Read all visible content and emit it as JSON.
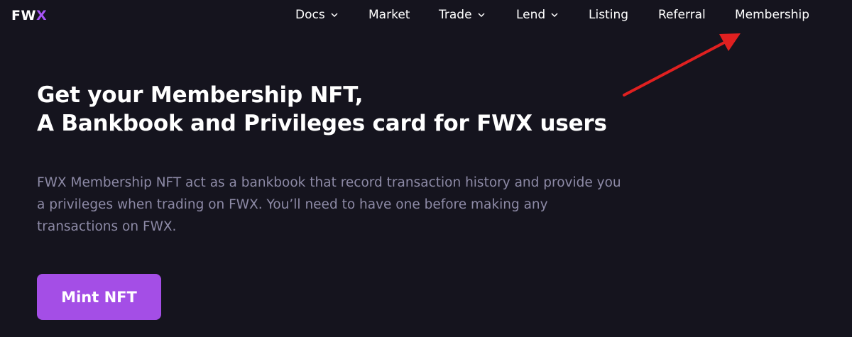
{
  "logo": {
    "part1": "FW",
    "part2": "X"
  },
  "nav": {
    "items": [
      {
        "label": "Docs",
        "dropdown": true
      },
      {
        "label": "Market",
        "dropdown": false
      },
      {
        "label": "Trade",
        "dropdown": true
      },
      {
        "label": "Lend",
        "dropdown": true
      },
      {
        "label": "Listing",
        "dropdown": false
      },
      {
        "label": "Referral",
        "dropdown": false
      },
      {
        "label": "Membership",
        "dropdown": false
      }
    ]
  },
  "hero": {
    "title_line1": "Get your Membership NFT,",
    "title_line2": "A Bankbook and Privileges card for FWX users",
    "description": "FWX Membership NFT act as a bankbook that record transaction history and provide you a privileges when trading on FWX. You’ll need to have one before making any transactions on FWX.",
    "cta_label": "Mint NFT"
  },
  "colors": {
    "background": "#15141e",
    "accent": "#a44ee6",
    "muted_text": "#8d8aa6",
    "annotation_arrow": "#e02020"
  }
}
